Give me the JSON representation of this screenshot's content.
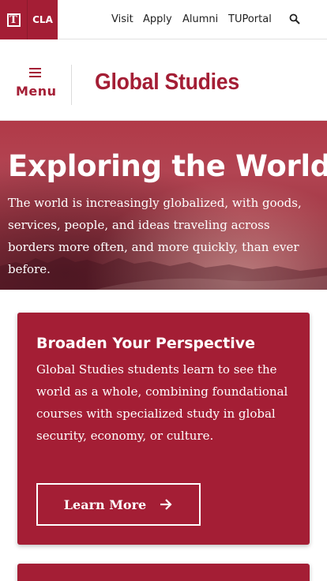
{
  "topbar": {
    "logo_letter": "T",
    "college_label": "CLA",
    "nav": [
      {
        "label": "Visit"
      },
      {
        "label": "Apply"
      },
      {
        "label": "Alumni"
      },
      {
        "label": "TUPortal"
      }
    ],
    "search_icon": "search-icon"
  },
  "header": {
    "menu_label": "Menu",
    "menu_icon": "hamburger-icon",
    "site_title": "Global Studies"
  },
  "hero": {
    "title": "Exploring the World",
    "body": "The world is increasingly globalized, with goods, services, people, and ideas traveling across borders more often, and more quickly, than ever before."
  },
  "cards": [
    {
      "title": "Broaden Your Perspective",
      "body": "Global Studies students learn to see the world as a whole, combining foundational courses with specialized study in global security, economy, or culture.",
      "button_label": "Learn More",
      "button_icon": "arrow-right-icon"
    }
  ],
  "colors": {
    "brand": "#a41e35",
    "text": "#222222",
    "background": "#ffffff"
  }
}
